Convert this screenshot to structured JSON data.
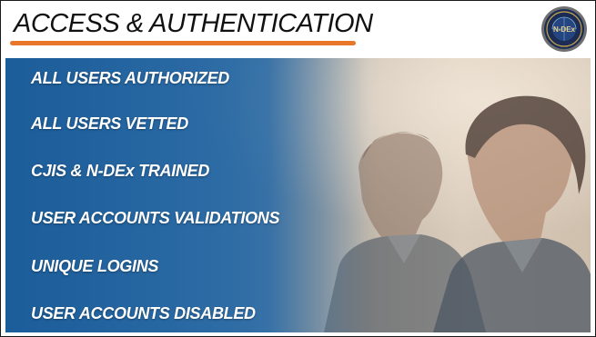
{
  "header": {
    "title": "ACCESS & AUTHENTICATION",
    "logo_text": "N-DEx",
    "accent_color": "#e8762b"
  },
  "list": {
    "items": [
      "ALL USERS AUTHORIZED",
      "ALL USERS VETTED",
      "CJIS & N-DEx TRAINED",
      "USER ACCOUNTS VALIDATIONS",
      "UNIQUE LOGINS",
      "USER ACCOUNTS  DISABLED"
    ]
  },
  "colors": {
    "panel_blue": "#1b5d9a",
    "panel_beige": "#d9cbbb",
    "text": "#ffffff"
  }
}
